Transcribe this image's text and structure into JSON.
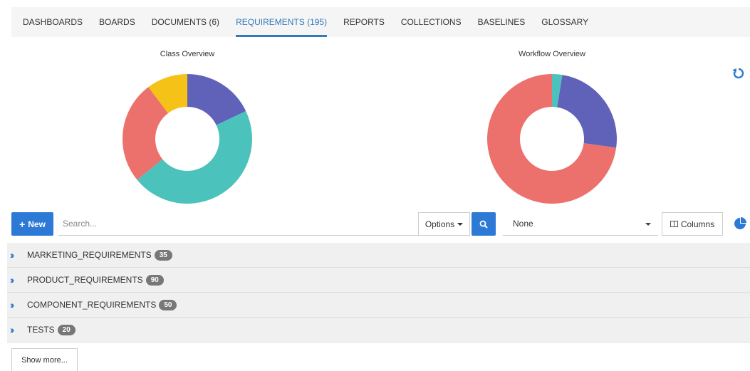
{
  "tabs": [
    {
      "label": "DASHBOARDS"
    },
    {
      "label": "BOARDS"
    },
    {
      "label": "DOCUMENTS (6)"
    },
    {
      "label": "REQUIREMENTS (195)"
    },
    {
      "label": "REPORTS"
    },
    {
      "label": "COLLECTIONS"
    },
    {
      "label": "BASELINES"
    },
    {
      "label": "GLOSSARY"
    }
  ],
  "active_tab": "REQUIREMENTS (195)",
  "charts": {
    "class": {
      "title": "Class Overview"
    },
    "workflow": {
      "title": "Workflow Overview"
    }
  },
  "chart_data": [
    {
      "type": "pie",
      "title": "Class Overview",
      "values": [
        35,
        90,
        50,
        20
      ],
      "colors": [
        "#5f62b8",
        "#4cc2bd",
        "#ec706c",
        "#f5c218"
      ]
    },
    {
      "type": "pie",
      "title": "Workflow Overview",
      "values": [
        5,
        48,
        142
      ],
      "colors": [
        "#4cc2bd",
        "#5f62b8",
        "#ec706c"
      ]
    }
  ],
  "toolbar": {
    "new_label": "New",
    "search_placeholder": "Search...",
    "options_label": "Options",
    "group_select_value": "None",
    "columns_label": "Columns"
  },
  "groups": [
    {
      "name": "MARKETING_REQUIREMENTS",
      "count": "35"
    },
    {
      "name": "PRODUCT_REQUIREMENTS",
      "count": "90"
    },
    {
      "name": "COMPONENT_REQUIREMENTS",
      "count": "50"
    },
    {
      "name": "TESTS",
      "count": "20"
    }
  ],
  "show_more_label": "Show more...",
  "icons": {
    "refresh": "refresh-icon",
    "search": "search-icon",
    "pie": "pie-chart-icon",
    "chevron": "double-chevron-right-icon"
  },
  "colors": {
    "accent": "#2d7ad6",
    "badge": "#777777"
  }
}
